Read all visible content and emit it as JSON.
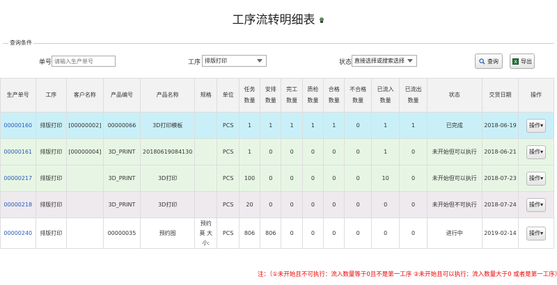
{
  "page": {
    "title": "工序流转明细表",
    "title_icon": "toolbox-icon"
  },
  "query": {
    "legend": "查询条件",
    "order_no_label": "单号",
    "order_no_placeholder": "请输入生产单号",
    "process_label": "工序",
    "process_value": "排版打印",
    "status_label": "状态",
    "status_value": "直接选择或搜索选择",
    "search_button": "查询",
    "export_button": "导出"
  },
  "table": {
    "headers": [
      [
        "生产单号"
      ],
      [
        "工序"
      ],
      [
        "客户名称"
      ],
      [
        "产品编号"
      ],
      [
        "产品名称"
      ],
      [
        "规格"
      ],
      [
        "单位"
      ],
      [
        "任务",
        "数量"
      ],
      [
        "安排",
        "数量"
      ],
      [
        "完工",
        "数量"
      ],
      [
        "质检",
        "数量"
      ],
      [
        "合格",
        "数量"
      ],
      [
        "不合格",
        "数量"
      ],
      [
        "已流入",
        "数量"
      ],
      [
        "已流出",
        "数量"
      ],
      [
        "状态"
      ],
      [
        "交货日期"
      ],
      [
        "操作"
      ]
    ],
    "rows": [
      {
        "order_no": "00000160",
        "process": "排版打印",
        "customer": "[00000002]",
        "product_no": "00000066",
        "product_name": "3D打印模板",
        "spec": "",
        "unit": "PCS",
        "task": "1",
        "arranged": "1",
        "completed": "1",
        "inspected": "1",
        "qualified": "1",
        "unqualified": "0",
        "inflow": "1",
        "outflow": "1",
        "status": "已完成",
        "delivery": "2018-06-19",
        "op": "操作▾"
      },
      {
        "order_no": "00000161",
        "process": "排版打印",
        "customer": "[00000004]",
        "product_no": "3D_PRINT",
        "product_name": "20180619084130",
        "spec": "",
        "unit": "PCS",
        "task": "1",
        "arranged": "0",
        "completed": "0",
        "inspected": "0",
        "qualified": "0",
        "unqualified": "0",
        "inflow": "1",
        "outflow": "0",
        "status": "未开始但可以执行",
        "delivery": "2018-06-21",
        "op": "操作▾"
      },
      {
        "order_no": "00000217",
        "process": "排版打印",
        "customer": "",
        "product_no": "3D_PRINT",
        "product_name": "3D打印",
        "spec": "",
        "unit": "PCS",
        "task": "100",
        "arranged": "0",
        "completed": "0",
        "inspected": "0",
        "qualified": "0",
        "unqualified": "0",
        "inflow": "10",
        "outflow": "0",
        "status": "未开始但可以执行",
        "delivery": "2018-07-23",
        "op": "操作▾"
      },
      {
        "order_no": "00000218",
        "process": "排版打印",
        "customer": "",
        "product_no": "3D_PRINT",
        "product_name": "3D打印",
        "spec": "",
        "unit": "PCS",
        "task": "20",
        "arranged": "0",
        "completed": "0",
        "inspected": "0",
        "qualified": "0",
        "unqualified": "0",
        "inflow": "0",
        "outflow": "0",
        "status": "未开始但不可执行",
        "delivery": "2018-07-24",
        "op": "操作▾"
      },
      {
        "order_no": "00000240",
        "process": "排版打印",
        "customer": "",
        "product_no": "00000035",
        "product_name": "预约图",
        "spec": "预约 莫 大小:",
        "unit": "PCS",
        "task": "806",
        "arranged": "806",
        "completed": "0",
        "inspected": "0",
        "qualified": "0",
        "unqualified": "0",
        "inflow": "0",
        "outflow": "0",
        "status": "进行中",
        "delivery": "2019-02-14",
        "op": "操作▾"
      }
    ]
  },
  "note": "注：（①未开始且不可执行：流入数量等于0且不是第一工序  ②未开始且可以执行：流入数量大于0 或者是第一工序）",
  "colors": {
    "row_completed": "#c9f0f8",
    "row_executable": "#e7f6e4",
    "row_blocked": "#eeeaee",
    "row_in_progress": "#ffffff",
    "link": "#2a5ab8",
    "note": "#e00000"
  }
}
